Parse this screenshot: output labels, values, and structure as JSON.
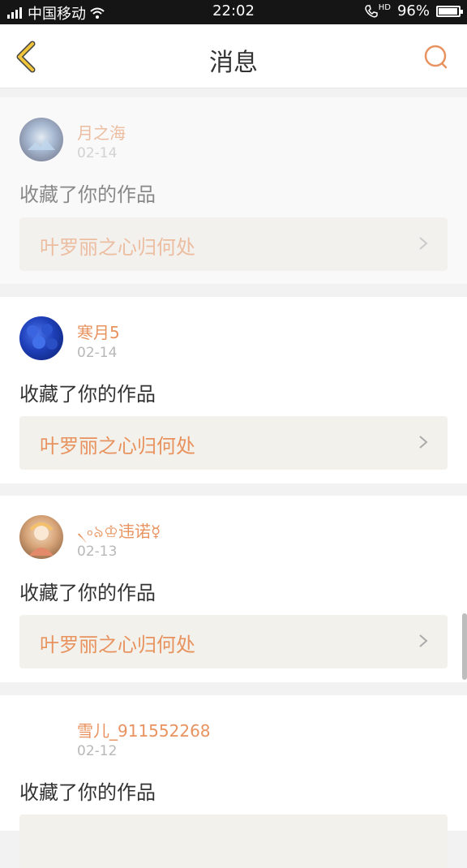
{
  "status_bar": {
    "carrier": "中国移动",
    "time": "22:02",
    "hd": "HD",
    "battery": "96%",
    "battery_level": 0.96
  },
  "header": {
    "title": "消息"
  },
  "messages": [
    {
      "user": "月之海",
      "date": "02-14",
      "action": "收藏了你的作品",
      "work": "叶罗丽之心归何处"
    },
    {
      "user": "寒月5",
      "date": "02-14",
      "action": "收藏了你的作品",
      "work": "叶罗丽之心归何处"
    },
    {
      "user": "৲৹৯♔违诺☿",
      "date": "02-13",
      "action": "收藏了你的作品",
      "work": "叶罗丽之心归何处"
    },
    {
      "user": "雪儿_911552268",
      "date": "02-12",
      "action": "收藏了你的作品",
      "work": ""
    }
  ],
  "icons": {
    "back": "chevron-left-icon",
    "search": "search-icon",
    "arrow": "chevron-right-icon"
  },
  "colors": {
    "accent": "#e8935f",
    "back_icon": "#f0c43a",
    "card_highlight": "#f3f1eb"
  }
}
